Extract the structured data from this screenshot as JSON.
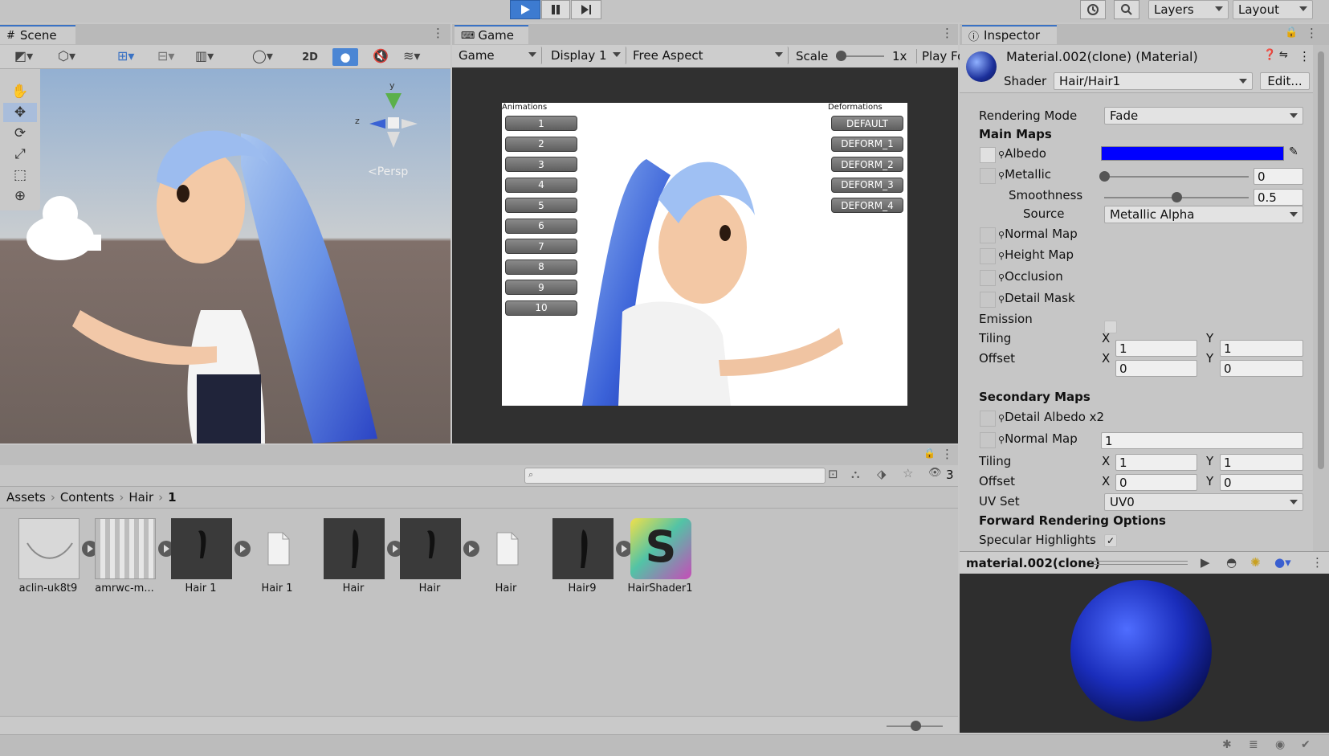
{
  "toolbar": {
    "layers_label": "Layers",
    "layout_label": "Layout"
  },
  "scene": {
    "tab_label": "Scene",
    "twod_label": "2D",
    "persp_label": "<Persp",
    "gizmo_y": "y",
    "gizmo_z": "z"
  },
  "game": {
    "tab_label": "Game",
    "game_dropdown": "Game",
    "display_dropdown": "Display 1",
    "aspect_dropdown": "Free Aspect",
    "scale_label": "Scale",
    "scale_value": "1x",
    "play_focused": "Play Fo",
    "animations_label": "Animations",
    "deformations_label": "Deformations",
    "animation_buttons": [
      "1",
      "2",
      "3",
      "4",
      "5",
      "6",
      "7",
      "8",
      "9",
      "10"
    ],
    "deform_buttons": [
      "DEFAULT",
      "DEFORM_1",
      "DEFORM_2",
      "DEFORM_3",
      "DEFORM_4"
    ]
  },
  "inspector": {
    "tab_label": "Inspector",
    "material_name": "Material.002(clone) (Material)",
    "shader_label": "Shader",
    "shader_value": "Hair/Hair1",
    "edit_button": "Edit...",
    "rendering_mode_label": "Rendering Mode",
    "rendering_mode_value": "Fade",
    "main_maps_header": "Main Maps",
    "albedo_label": "Albedo",
    "albedo_color": "#0000ff",
    "metallic_label": "Metallic",
    "metallic_value": "0",
    "smoothness_label": "Smoothness",
    "smoothness_value": "0.5",
    "source_label": "Source",
    "source_value": "Metallic Alpha",
    "normal_map_label": "Normal Map",
    "height_map_label": "Height Map",
    "occlusion_label": "Occlusion",
    "detail_mask_label": "Detail Mask",
    "emission_label": "Emission",
    "tiling_label": "Tiling",
    "offset_label": "Offset",
    "x_label": "X",
    "y_label": "Y",
    "main_tiling_x": "1",
    "main_tiling_y": "1",
    "main_offset_x": "0",
    "main_offset_y": "0",
    "secondary_maps_header": "Secondary Maps",
    "detail_albedo_label": "Detail Albedo x2",
    "secondary_normal_label": "Normal Map",
    "secondary_normal_value": "1",
    "sec_tiling_x": "1",
    "sec_tiling_y": "1",
    "sec_offset_x": "0",
    "sec_offset_y": "0",
    "uv_set_label": "UV Set",
    "uv_set_value": "UV0",
    "forward_header": "Forward Rendering Options",
    "specular_label": "Specular Highlights",
    "specular_check": "✓",
    "preview_name": "material.002(clone)"
  },
  "project": {
    "breadcrumb": [
      "Assets",
      "Contents",
      "Hair",
      "1"
    ],
    "hidden_count": "3",
    "assets": [
      {
        "name": "aclin-uk8t9",
        "kind": "texture"
      },
      {
        "name": "amrwc-m...",
        "kind": "texture-blur"
      },
      {
        "name": "Hair 1",
        "kind": "mesh"
      },
      {
        "name": "Hair 1",
        "kind": "file"
      },
      {
        "name": "Hair",
        "kind": "mesh"
      },
      {
        "name": "Hair",
        "kind": "mesh"
      },
      {
        "name": "Hair",
        "kind": "file"
      },
      {
        "name": "Hair9",
        "kind": "mesh"
      },
      {
        "name": "HairShader1",
        "kind": "shader"
      }
    ],
    "shader_letter": "S"
  },
  "colors": {
    "accent": "#3a72c4",
    "albedo": "#0000ff"
  }
}
